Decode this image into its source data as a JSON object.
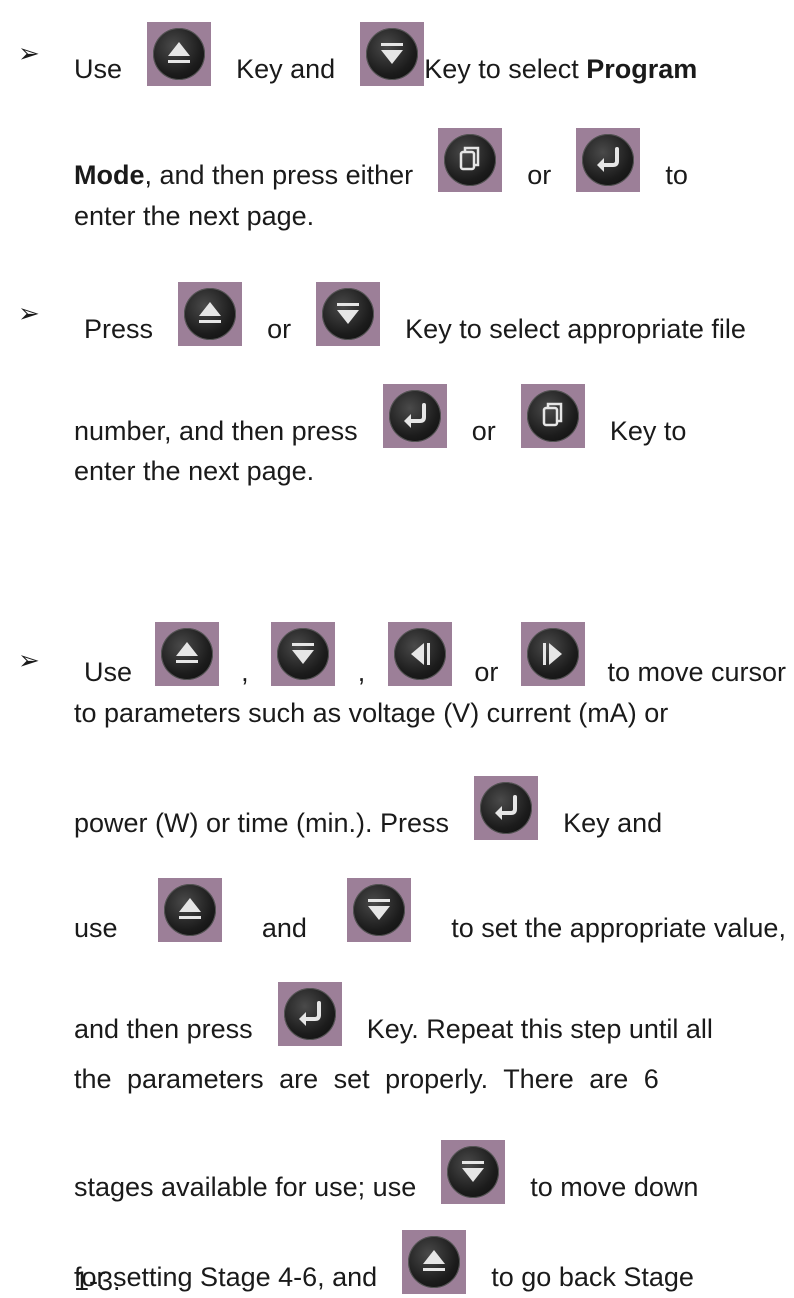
{
  "bullet_glyph": "➢",
  "b1": {
    "l1": {
      "t1": "Use",
      "t2": "Key and",
      "t3": "Key to select ",
      "t4": "Program"
    },
    "l2": {
      "t1": "Mode",
      "t2": ", and then press either",
      "t3": "or",
      "t4": "to"
    },
    "l3": {
      "t1": "enter the next page."
    }
  },
  "b2": {
    "l1": {
      "t1": "Press",
      "t2": "or",
      "t3": "Key to select appropriate file"
    },
    "l2": {
      "t1": "number, and then press",
      "t2": "or",
      "t3": "Key to"
    },
    "l3": {
      "t1": "enter the next page."
    }
  },
  "b3": {
    "l1": {
      "t1": "Use",
      "t2": ",",
      "t3": ",",
      "t4": "or",
      "t5": "to move cursor"
    },
    "l2": {
      "t1": "to parameters such as voltage (V) current (mA) or"
    },
    "l3": {
      "t1": "power (W) or time (min.). Press",
      "t2": "Key and"
    },
    "l4": {
      "t1": "use",
      "t2": "and",
      "t3": "to set the appropriate value,"
    },
    "l5": {
      "t1": "and then press",
      "t2": "Key. Repeat this step until all"
    },
    "l6": {
      "t1": "the parameters are set properly. There are 6"
    },
    "l7": {
      "t1": "stages available for use; use",
      "t2": "to move down"
    },
    "l8": {
      "t1": "for setting Stage 4-6, and",
      "t2": "to go back Stage"
    },
    "l9": {
      "t1": "1-3."
    }
  },
  "icons": [
    "up-key-icon",
    "down-key-icon",
    "page-key-icon",
    "enter-key-icon",
    "left-key-icon",
    "right-key-icon"
  ],
  "colors": {
    "key_background": "#9c7f98",
    "key_button": "#1c1c1c",
    "key_symbol": "#e8e8e8"
  }
}
